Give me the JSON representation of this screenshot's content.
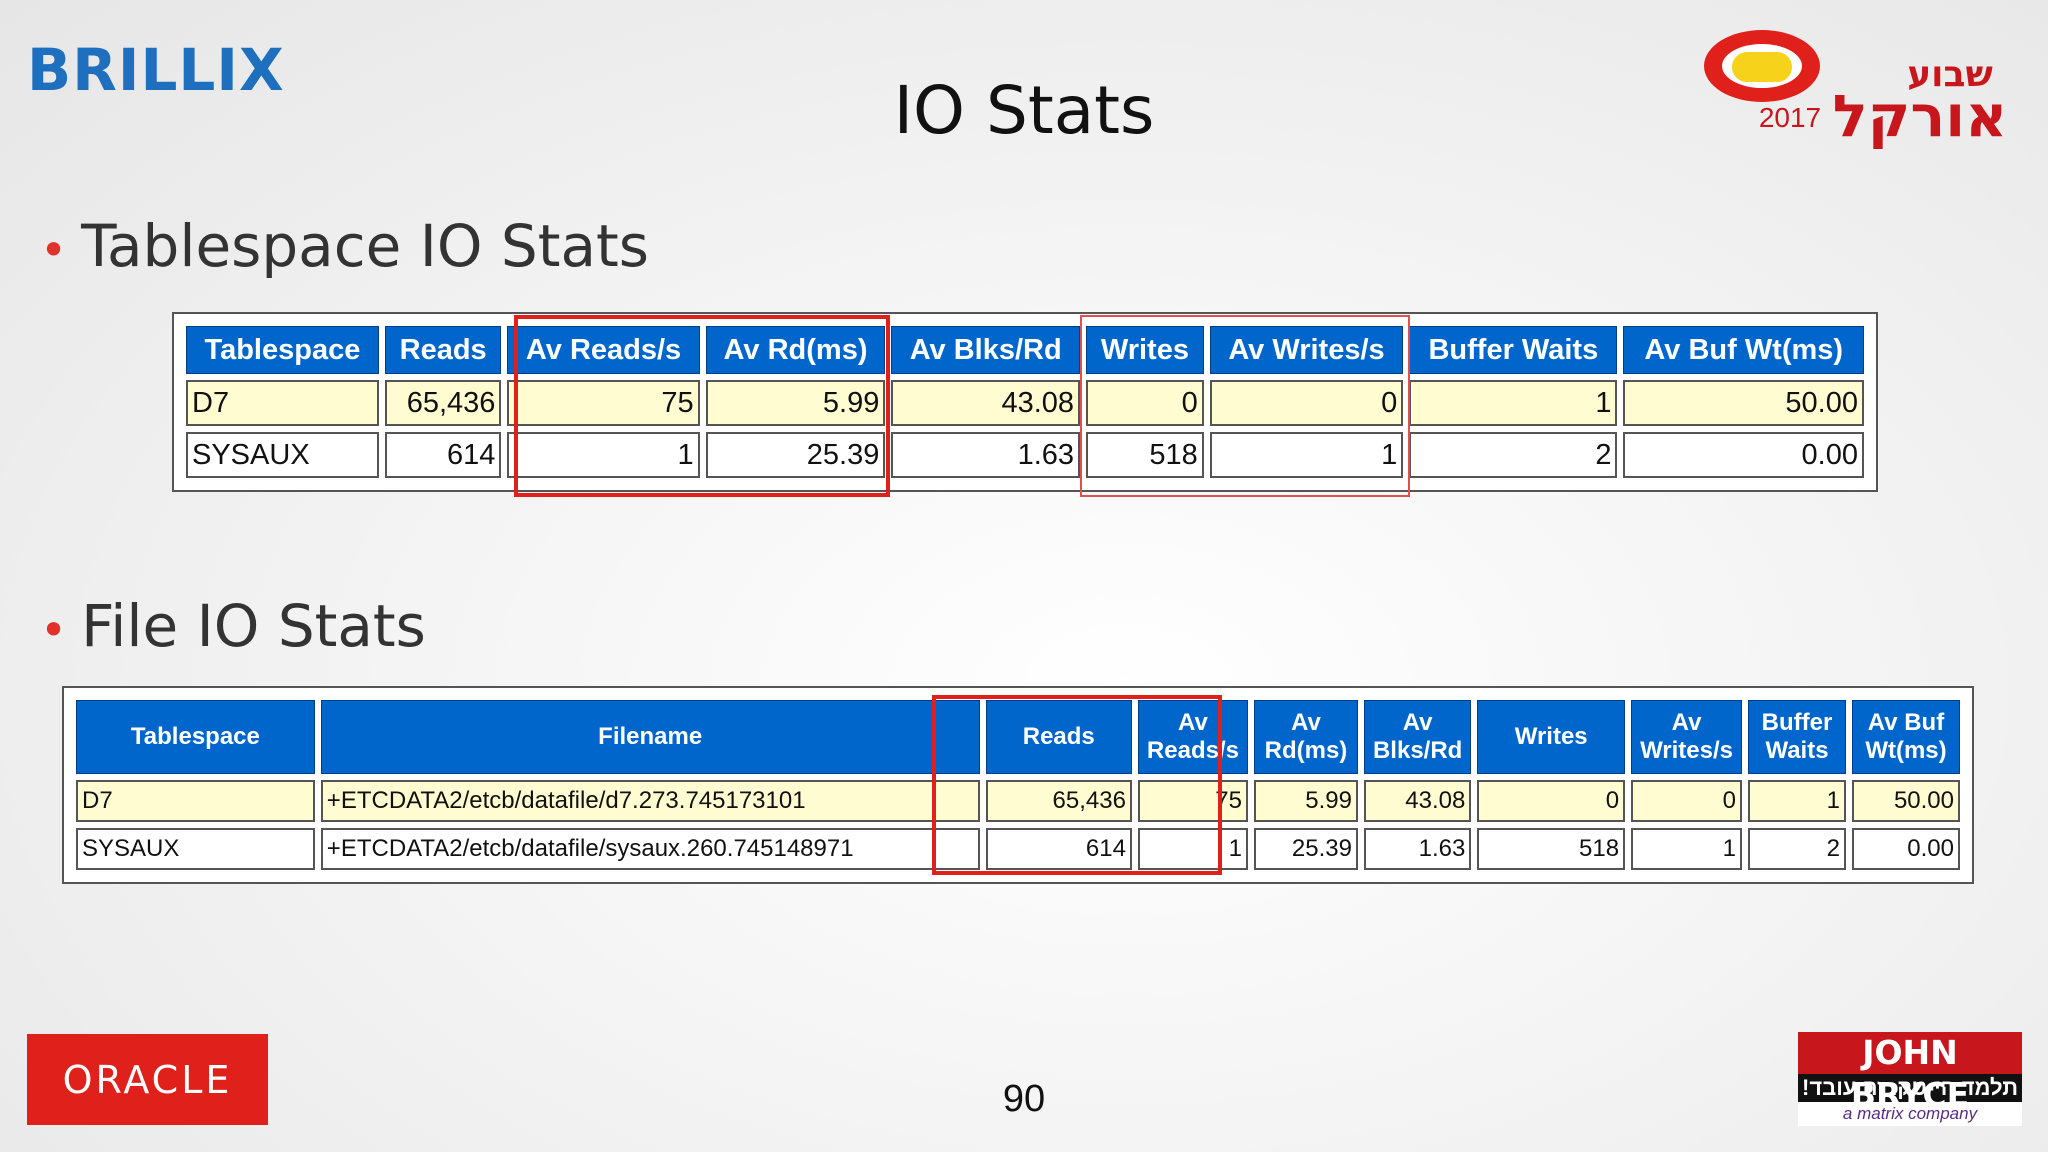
{
  "header": {
    "brillix_logo": "BRILLIX",
    "title": "IO Stats",
    "oracle_week_logo": {
      "hebrew_top": "שבוע",
      "hebrew_main": "אורקל",
      "year": "2017"
    }
  },
  "section1": {
    "bullet": "Tablespace IO Stats",
    "table": {
      "headers": [
        "Tablespace",
        "Reads",
        "Av Reads/s",
        "Av Rd(ms)",
        "Av Blks/Rd",
        "Writes",
        "Av Writes/s",
        "Buffer Waits",
        "Av Buf Wt(ms)"
      ],
      "rows": [
        [
          "D7",
          "65,436",
          "75",
          "5.99",
          "43.08",
          "0",
          "0",
          "1",
          "50.00"
        ],
        [
          "SYSAUX",
          "614",
          "1",
          "25.39",
          "1.63",
          "518",
          "1",
          "2",
          "0.00"
        ]
      ]
    }
  },
  "section2": {
    "bullet": "File IO Stats",
    "table": {
      "headers": [
        "Tablespace",
        "Filename",
        "Reads",
        "Av Reads/s",
        "Av Rd(ms)",
        "Av Blks/Rd",
        "Writes",
        "Av Writes/s",
        "Buffer Waits",
        "Av Buf Wt(ms)"
      ],
      "rows": [
        [
          "D7",
          "+ETCDATA2/etcb/datafile/d7.273.745173101",
          "65,436",
          "75",
          "5.99",
          "43.08",
          "0",
          "0",
          "1",
          "50.00"
        ],
        [
          "SYSAUX",
          "+ETCDATA2/etcb/datafile/sysaux.260.745148971",
          "614",
          "1",
          "25.39",
          "1.63",
          "518",
          "1",
          "2",
          "0.00"
        ]
      ]
    }
  },
  "footer": {
    "page_number": "90",
    "oracle_logo": "ORACLE",
    "john_bryce": {
      "name": "JOHN BRYCE",
      "tagline": "תלמד הי-טק. זה עובד!",
      "company": "a matrix company"
    }
  },
  "colors": {
    "header_blue": "#0066cc",
    "row_highlight": "#fffcd2",
    "accent_red": "#e0201a",
    "brillix_blue": "#1f6fbf"
  }
}
